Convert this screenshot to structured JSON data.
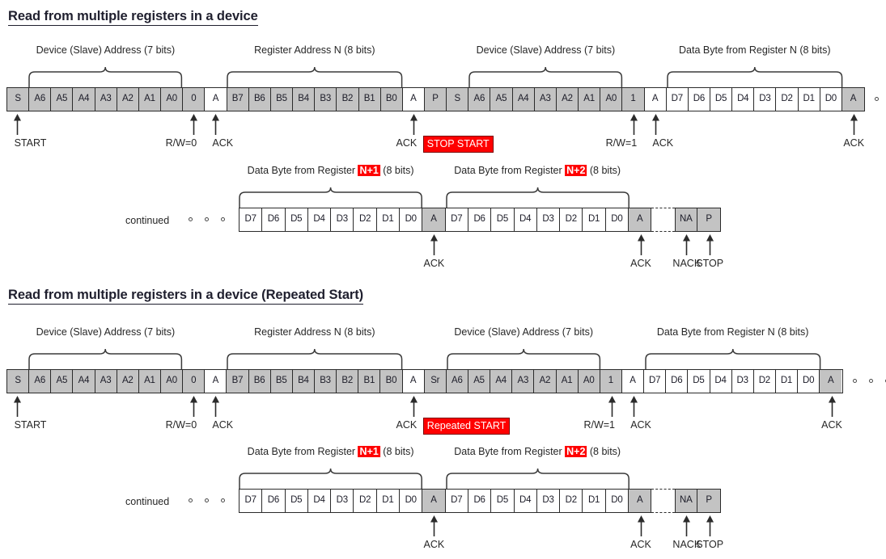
{
  "page": {
    "bg": "#ffffff",
    "cell_gray": "#c3c3c3",
    "cell_white": "#ffffff",
    "accent_red": "#ff0000",
    "ink": "#262626"
  },
  "sections": [
    {
      "id": "plain-stop-start",
      "title": "Read from multiple registers in a device",
      "row1": {
        "cells": [
          {
            "label": "S",
            "fill": "gray"
          },
          {
            "label": "A6",
            "fill": "gray"
          },
          {
            "label": "A5",
            "fill": "gray"
          },
          {
            "label": "A4",
            "fill": "gray"
          },
          {
            "label": "A3",
            "fill": "gray"
          },
          {
            "label": "A2",
            "fill": "gray"
          },
          {
            "label": "A1",
            "fill": "gray"
          },
          {
            "label": "A0",
            "fill": "gray"
          },
          {
            "label": "0",
            "fill": "gray"
          },
          {
            "label": "A",
            "fill": "white"
          },
          {
            "label": "B7",
            "fill": "gray"
          },
          {
            "label": "B6",
            "fill": "gray"
          },
          {
            "label": "B5",
            "fill": "gray"
          },
          {
            "label": "B4",
            "fill": "gray"
          },
          {
            "label": "B3",
            "fill": "gray"
          },
          {
            "label": "B2",
            "fill": "gray"
          },
          {
            "label": "B1",
            "fill": "gray"
          },
          {
            "label": "B0",
            "fill": "gray"
          },
          {
            "label": "A",
            "fill": "white"
          },
          {
            "label": "P",
            "fill": "gray"
          },
          {
            "label": "S",
            "fill": "gray"
          },
          {
            "label": "A6",
            "fill": "gray"
          },
          {
            "label": "A5",
            "fill": "gray"
          },
          {
            "label": "A4",
            "fill": "gray"
          },
          {
            "label": "A3",
            "fill": "gray"
          },
          {
            "label": "A2",
            "fill": "gray"
          },
          {
            "label": "A1",
            "fill": "gray"
          },
          {
            "label": "A0",
            "fill": "gray"
          },
          {
            "label": "1",
            "fill": "gray"
          },
          {
            "label": "A",
            "fill": "white"
          },
          {
            "label": "D7",
            "fill": "white"
          },
          {
            "label": "D6",
            "fill": "white"
          },
          {
            "label": "D5",
            "fill": "white"
          },
          {
            "label": "D4",
            "fill": "white"
          },
          {
            "label": "D3",
            "fill": "white"
          },
          {
            "label": "D2",
            "fill": "white"
          },
          {
            "label": "D1",
            "fill": "white"
          },
          {
            "label": "D0",
            "fill": "white"
          },
          {
            "label": "A",
            "fill": "gray"
          }
        ],
        "braces": [
          {
            "label": "Device (Slave) Address (7 bits)",
            "from": 1,
            "to": 7
          },
          {
            "label": "Register Address N (8 bits)",
            "from": 10,
            "to": 17
          },
          {
            "label": "Device (Slave) Address (7 bits)",
            "from": 21,
            "to": 27
          },
          {
            "label": "Data Byte from Register N (8 bits)",
            "from": 30,
            "to": 37
          }
        ],
        "callouts": [
          {
            "label": "START",
            "cell": 0,
            "align": "left"
          },
          {
            "label": "R/W=0",
            "cell": 8,
            "align": "right"
          },
          {
            "label": "ACK",
            "cell": 9,
            "align": "left"
          },
          {
            "label": "ACK",
            "cell": 18,
            "align": "right"
          },
          {
            "label": "R/W=1",
            "cell": 28,
            "align": "right"
          },
          {
            "label": "ACK",
            "cell": 29,
            "align": "left"
          },
          {
            "label": "ACK",
            "cell": 38,
            "align": "center"
          }
        ],
        "redbox": {
          "label": "STOP  START",
          "from": 19,
          "to": 20
        }
      },
      "row2": {
        "continued_label": "continued",
        "cells": [
          {
            "label": "D7",
            "fill": "white"
          },
          {
            "label": "D6",
            "fill": "white"
          },
          {
            "label": "D5",
            "fill": "white"
          },
          {
            "label": "D4",
            "fill": "white"
          },
          {
            "label": "D3",
            "fill": "white"
          },
          {
            "label": "D2",
            "fill": "white"
          },
          {
            "label": "D1",
            "fill": "white"
          },
          {
            "label": "D0",
            "fill": "white"
          },
          {
            "label": "A",
            "fill": "gray"
          },
          {
            "label": "D7",
            "fill": "white"
          },
          {
            "label": "D6",
            "fill": "white"
          },
          {
            "label": "D5",
            "fill": "white"
          },
          {
            "label": "D4",
            "fill": "white"
          },
          {
            "label": "D3",
            "fill": "white"
          },
          {
            "label": "D2",
            "fill": "white"
          },
          {
            "label": "D1",
            "fill": "white"
          },
          {
            "label": "D0",
            "fill": "white"
          },
          {
            "label": "A",
            "fill": "gray"
          },
          {
            "label": "",
            "fill": "gap"
          },
          {
            "label": "NA",
            "fill": "gray"
          },
          {
            "label": "P",
            "fill": "gray"
          }
        ],
        "braces": [
          {
            "label_pre": "Data Byte from Register ",
            "label_hl": "N+1",
            "label_post": " (8 bits)",
            "from": 0,
            "to": 7
          },
          {
            "label_pre": "Data Byte from Register ",
            "label_hl": "N+2",
            "label_post": " (8 bits)",
            "from": 9,
            "to": 16
          }
        ],
        "callouts": [
          {
            "label": "ACK",
            "cell": 8,
            "align": "center"
          },
          {
            "label": "ACK",
            "cell": 17,
            "align": "center"
          },
          {
            "label": "NACK",
            "cell": 19,
            "align": "center"
          },
          {
            "label": "STOP",
            "cell": 20,
            "align": "center"
          }
        ]
      }
    },
    {
      "id": "repeated-start",
      "title": "Read from multiple registers in a device (Repeated Start)",
      "row1": {
        "cells": [
          {
            "label": "S",
            "fill": "gray"
          },
          {
            "label": "A6",
            "fill": "gray"
          },
          {
            "label": "A5",
            "fill": "gray"
          },
          {
            "label": "A4",
            "fill": "gray"
          },
          {
            "label": "A3",
            "fill": "gray"
          },
          {
            "label": "A2",
            "fill": "gray"
          },
          {
            "label": "A1",
            "fill": "gray"
          },
          {
            "label": "A0",
            "fill": "gray"
          },
          {
            "label": "0",
            "fill": "gray"
          },
          {
            "label": "A",
            "fill": "white"
          },
          {
            "label": "B7",
            "fill": "gray"
          },
          {
            "label": "B6",
            "fill": "gray"
          },
          {
            "label": "B5",
            "fill": "gray"
          },
          {
            "label": "B4",
            "fill": "gray"
          },
          {
            "label": "B3",
            "fill": "gray"
          },
          {
            "label": "B2",
            "fill": "gray"
          },
          {
            "label": "B1",
            "fill": "gray"
          },
          {
            "label": "B0",
            "fill": "gray"
          },
          {
            "label": "A",
            "fill": "white"
          },
          {
            "label": "Sr",
            "fill": "gray"
          },
          {
            "label": "A6",
            "fill": "gray"
          },
          {
            "label": "A5",
            "fill": "gray"
          },
          {
            "label": "A4",
            "fill": "gray"
          },
          {
            "label": "A3",
            "fill": "gray"
          },
          {
            "label": "A2",
            "fill": "gray"
          },
          {
            "label": "A1",
            "fill": "gray"
          },
          {
            "label": "A0",
            "fill": "gray"
          },
          {
            "label": "1",
            "fill": "gray"
          },
          {
            "label": "A",
            "fill": "white"
          },
          {
            "label": "D7",
            "fill": "white"
          },
          {
            "label": "D6",
            "fill": "white"
          },
          {
            "label": "D5",
            "fill": "white"
          },
          {
            "label": "D4",
            "fill": "white"
          },
          {
            "label": "D3",
            "fill": "white"
          },
          {
            "label": "D2",
            "fill": "white"
          },
          {
            "label": "D1",
            "fill": "white"
          },
          {
            "label": "D0",
            "fill": "white"
          },
          {
            "label": "A",
            "fill": "gray"
          }
        ],
        "braces": [
          {
            "label": "Device (Slave) Address (7 bits)",
            "from": 1,
            "to": 7
          },
          {
            "label": "Register Address N (8 bits)",
            "from": 10,
            "to": 17
          },
          {
            "label": "Device (Slave) Address (7 bits)",
            "from": 20,
            "to": 26
          },
          {
            "label": "Data Byte from Register N (8 bits)",
            "from": 29,
            "to": 36
          }
        ],
        "callouts": [
          {
            "label": "START",
            "cell": 0,
            "align": "left"
          },
          {
            "label": "R/W=0",
            "cell": 8,
            "align": "right"
          },
          {
            "label": "ACK",
            "cell": 9,
            "align": "left"
          },
          {
            "label": "ACK",
            "cell": 18,
            "align": "right"
          },
          {
            "label": "R/W=1",
            "cell": 27,
            "align": "right"
          },
          {
            "label": "ACK",
            "cell": 28,
            "align": "left"
          },
          {
            "label": "ACK",
            "cell": 37,
            "align": "center"
          }
        ],
        "redbox": {
          "label": "Repeated START",
          "from": 19,
          "to": 19
        }
      },
      "row2": {
        "continued_label": "continued",
        "cells": [
          {
            "label": "D7",
            "fill": "white"
          },
          {
            "label": "D6",
            "fill": "white"
          },
          {
            "label": "D5",
            "fill": "white"
          },
          {
            "label": "D4",
            "fill": "white"
          },
          {
            "label": "D3",
            "fill": "white"
          },
          {
            "label": "D2",
            "fill": "white"
          },
          {
            "label": "D1",
            "fill": "white"
          },
          {
            "label": "D0",
            "fill": "white"
          },
          {
            "label": "A",
            "fill": "gray"
          },
          {
            "label": "D7",
            "fill": "white"
          },
          {
            "label": "D6",
            "fill": "white"
          },
          {
            "label": "D5",
            "fill": "white"
          },
          {
            "label": "D4",
            "fill": "white"
          },
          {
            "label": "D3",
            "fill": "white"
          },
          {
            "label": "D2",
            "fill": "white"
          },
          {
            "label": "D1",
            "fill": "white"
          },
          {
            "label": "D0",
            "fill": "white"
          },
          {
            "label": "A",
            "fill": "gray"
          },
          {
            "label": "",
            "fill": "gap"
          },
          {
            "label": "NA",
            "fill": "gray"
          },
          {
            "label": "P",
            "fill": "gray"
          }
        ],
        "braces": [
          {
            "label_pre": "Data Byte from Register ",
            "label_hl": "N+1",
            "label_post": " (8 bits)",
            "from": 0,
            "to": 7
          },
          {
            "label_pre": "Data Byte from Register ",
            "label_hl": "N+2",
            "label_post": " (8 bits)",
            "from": 9,
            "to": 16
          }
        ],
        "callouts": [
          {
            "label": "ACK",
            "cell": 8,
            "align": "center"
          },
          {
            "label": "ACK",
            "cell": 17,
            "align": "center"
          },
          {
            "label": "NACK",
            "cell": 19,
            "align": "center"
          },
          {
            "label": "STOP",
            "cell": 20,
            "align": "center"
          }
        ]
      }
    }
  ]
}
